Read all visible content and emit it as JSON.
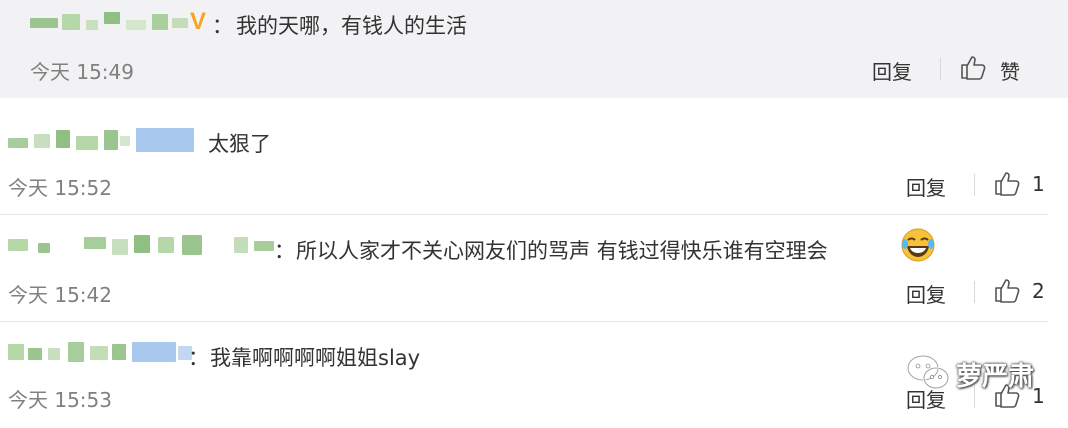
{
  "comments": [
    {
      "text": "我的天哪，有钱人的生活",
      "time": "今天 15:49",
      "reply_label": "回复",
      "like_label": "赞",
      "like_count": ""
    },
    {
      "text": "太狠了",
      "time": "今天 15:52",
      "reply_label": "回复",
      "like_label": "",
      "like_count": "1"
    },
    {
      "text": "所以人家才不关心网友们的骂声 有钱过得快乐谁有空理会",
      "time": "今天 15:42",
      "reply_label": "回复",
      "like_label": "",
      "like_count": "2"
    },
    {
      "text": "我靠啊啊啊啊姐姐slay",
      "time": "今天 15:53",
      "reply_label": "回复",
      "like_label": "",
      "like_count": "1"
    }
  ],
  "colon": "：",
  "badge": "V",
  "watermark": {
    "text": "萝严肃",
    "icon": "wechat-icon"
  },
  "colors": {
    "highlight_bg": "#f2f2f5",
    "time_text": "#808080",
    "badge": "#f5a623"
  }
}
